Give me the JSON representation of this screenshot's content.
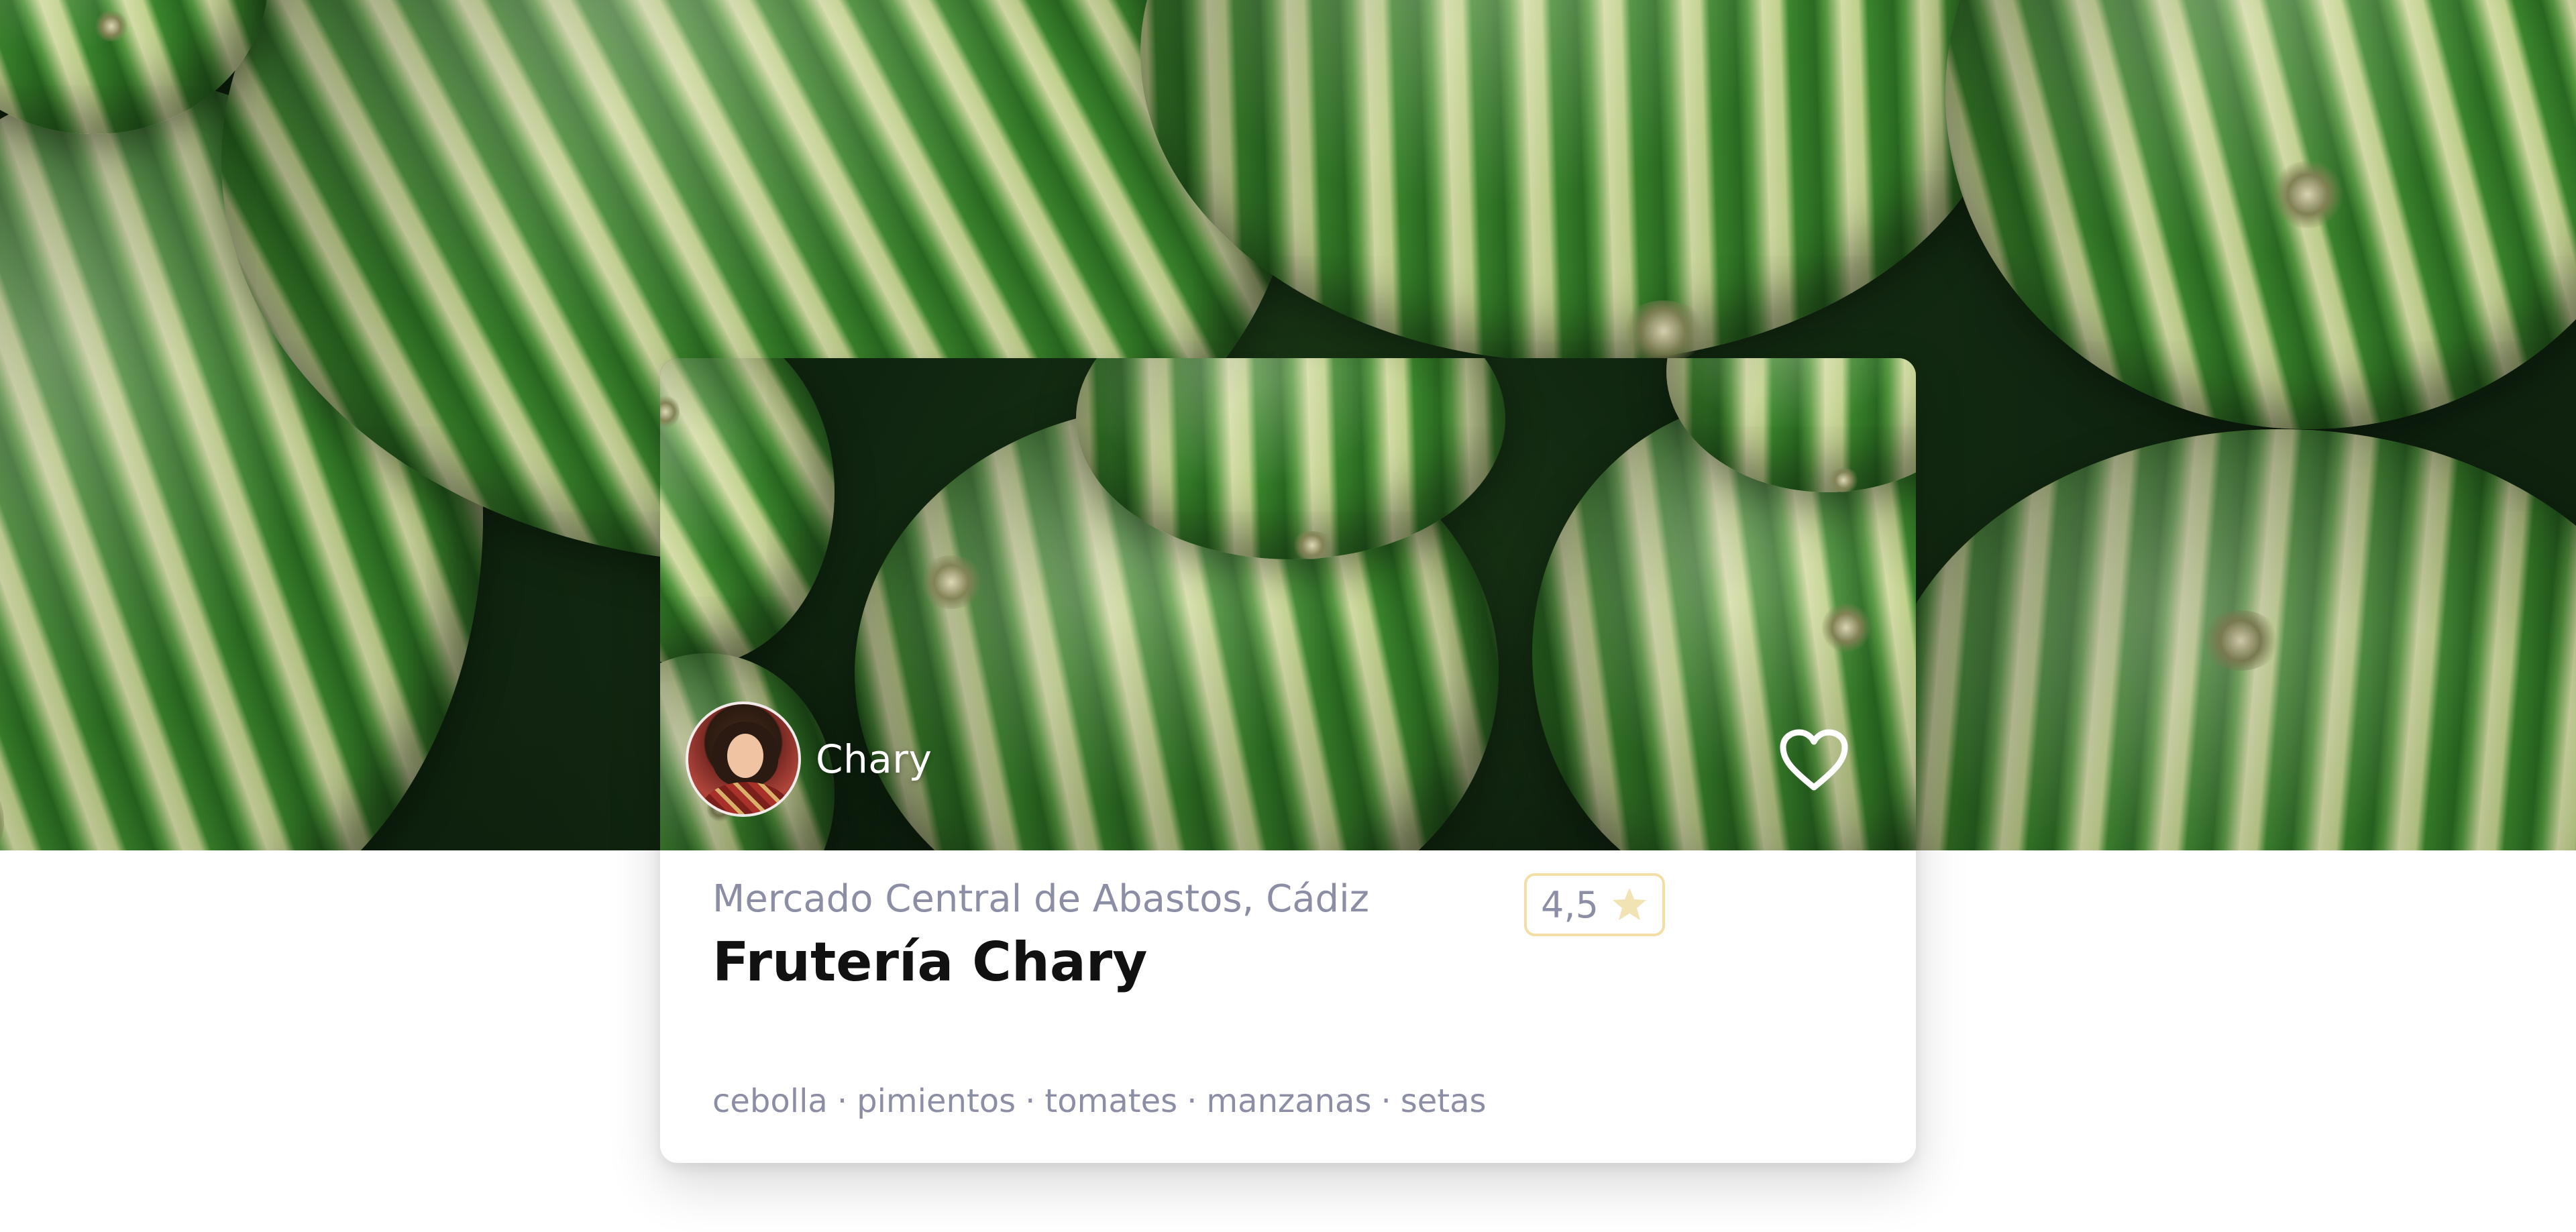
{
  "card": {
    "vendor_name": "Chary",
    "location": "Mercado Central de Abastos, Cádiz",
    "rating": "4,5",
    "title": "Frutería Chary",
    "tags": [
      "cebolla",
      "pimientos",
      "tomates",
      "manzanas",
      "setas"
    ],
    "tag_separator": "·"
  },
  "icons": {
    "favorite": "heart-outline-icon",
    "rating": "star-icon",
    "avatar": "vendor-avatar"
  },
  "colors": {
    "muted_text": "#8c8ea6",
    "title_text": "#111111",
    "rating_border": "#f3dfa6",
    "star": "#f1e3b4"
  }
}
